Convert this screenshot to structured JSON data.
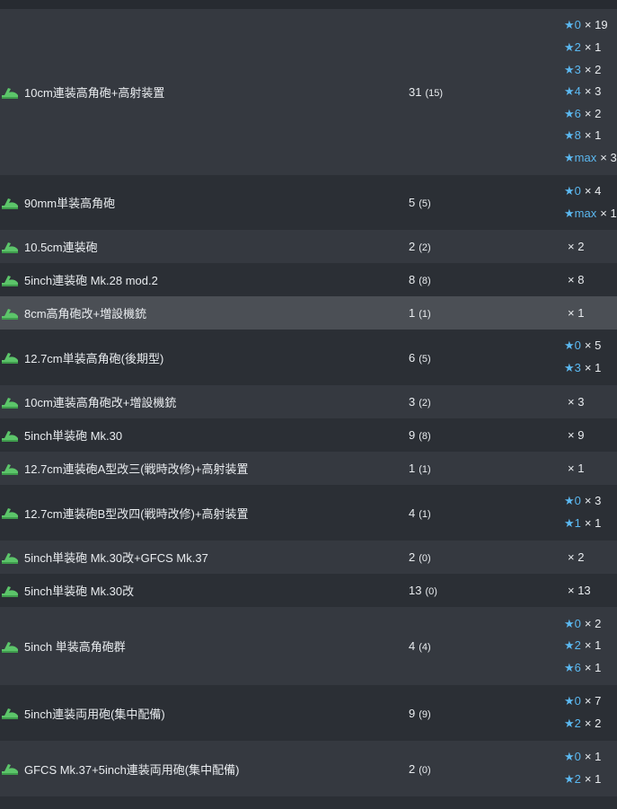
{
  "rows": [
    {
      "name": "10cm連装高角砲+高射装置",
      "count": "31",
      "paren": "(15)",
      "stars": [
        {
          "lvl": "0",
          "n": "19"
        },
        {
          "lvl": "2",
          "n": "1"
        },
        {
          "lvl": "3",
          "n": "2"
        },
        {
          "lvl": "4",
          "n": "3"
        },
        {
          "lvl": "6",
          "n": "2"
        },
        {
          "lvl": "8",
          "n": "1"
        },
        {
          "lvl": "max",
          "n": "3"
        }
      ]
    },
    {
      "name": "90mm単装高角砲",
      "count": "5",
      "paren": "(5)",
      "stars": [
        {
          "lvl": "0",
          "n": "4"
        },
        {
          "lvl": "max",
          "n": "1"
        }
      ]
    },
    {
      "name": "10.5cm連装砲",
      "count": "2",
      "paren": "(2)",
      "plain": "× 2"
    },
    {
      "name": "5inch連装砲 Mk.28 mod.2",
      "count": "8",
      "paren": "(8)",
      "plain": "× 8"
    },
    {
      "name": "8cm高角砲改+増設機銃",
      "count": "1",
      "paren": "(1)",
      "plain": "× 1"
    },
    {
      "name": "12.7cm単装高角砲(後期型)",
      "count": "6",
      "paren": "(5)",
      "stars": [
        {
          "lvl": "0",
          "n": "5"
        },
        {
          "lvl": "3",
          "n": "1"
        }
      ]
    },
    {
      "name": "10cm連装高角砲改+増設機銃",
      "count": "3",
      "paren": "(2)",
      "plain": "× 3"
    },
    {
      "name": "5inch単装砲 Mk.30",
      "count": "9",
      "paren": "(8)",
      "plain": "× 9"
    },
    {
      "name": "12.7cm連装砲A型改三(戦時改修)+高射装置",
      "count": "1",
      "paren": "(1)",
      "plain": "× 1"
    },
    {
      "name": "12.7cm連装砲B型改四(戦時改修)+高射装置",
      "count": "4",
      "paren": "(1)",
      "stars": [
        {
          "lvl": "0",
          "n": "3"
        },
        {
          "lvl": "1",
          "n": "1"
        }
      ]
    },
    {
      "name": "5inch単装砲 Mk.30改+GFCS Mk.37",
      "count": "2",
      "paren": "(0)",
      "plain": "× 2"
    },
    {
      "name": "5inch単装砲 Mk.30改",
      "count": "13",
      "paren": "(0)",
      "plain": "× 13"
    },
    {
      "name": "5inch 単装高角砲群",
      "count": "4",
      "paren": "(4)",
      "stars": [
        {
          "lvl": "0",
          "n": "2"
        },
        {
          "lvl": "2",
          "n": "1"
        },
        {
          "lvl": "6",
          "n": "1"
        }
      ]
    },
    {
      "name": "5inch連装両用砲(集中配備)",
      "count": "9",
      "paren": "(9)",
      "stars": [
        {
          "lvl": "0",
          "n": "7"
        },
        {
          "lvl": "2",
          "n": "2"
        }
      ]
    },
    {
      "name": "GFCS Mk.37+5inch連装両用砲(集中配備)",
      "count": "2",
      "paren": "(0)",
      "stars": [
        {
          "lvl": "0",
          "n": "1"
        },
        {
          "lvl": "2",
          "n": "1"
        }
      ]
    }
  ],
  "icon": "green-gun-icon",
  "colors": {
    "star": "#5bb8f0",
    "icon": "#5cc56a"
  }
}
